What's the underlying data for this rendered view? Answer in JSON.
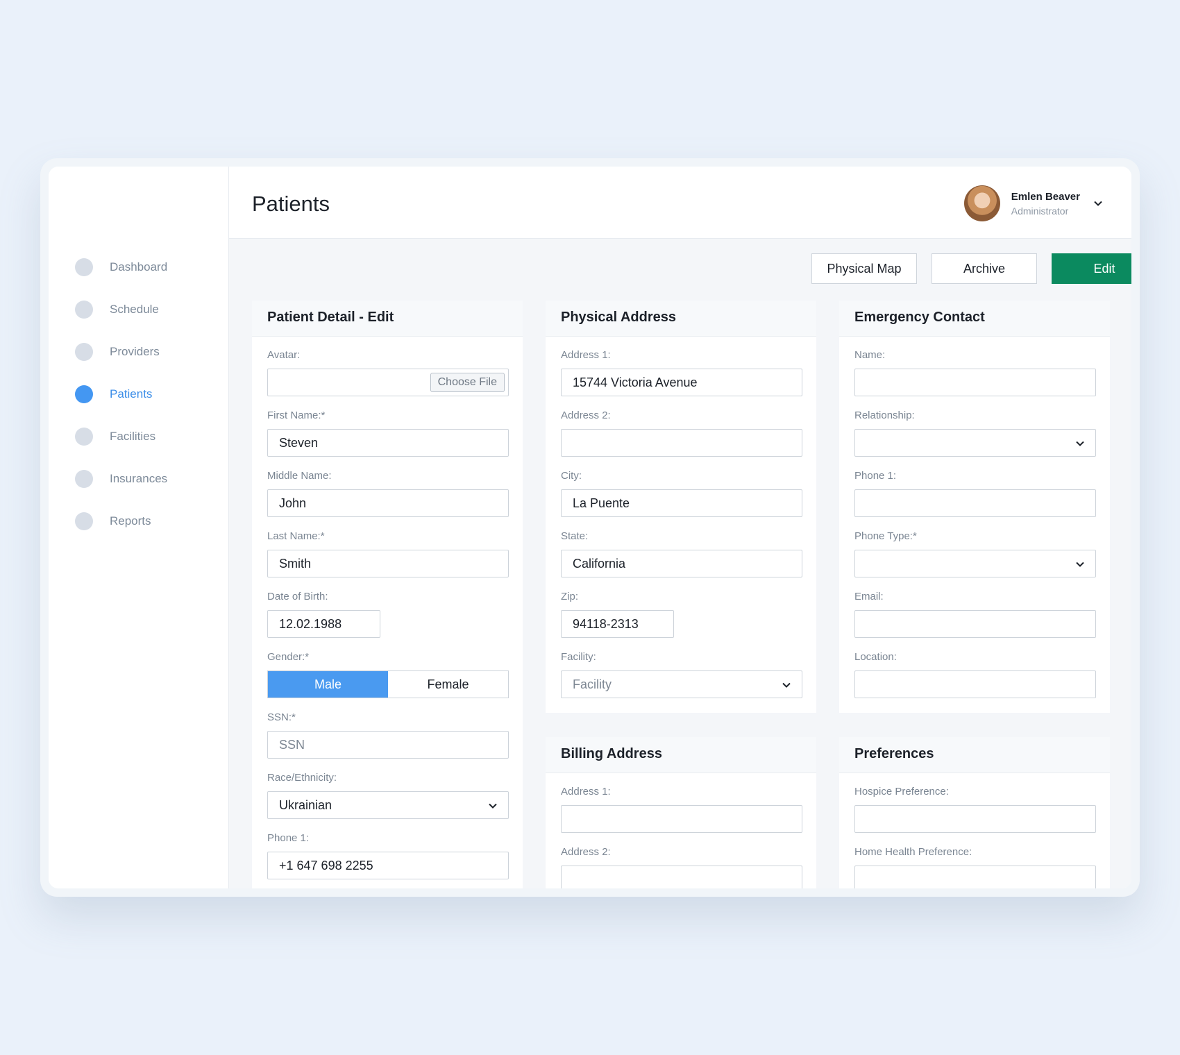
{
  "nav": {
    "items": [
      {
        "label": "Dashboard"
      },
      {
        "label": "Schedule"
      },
      {
        "label": "Providers"
      },
      {
        "label": "Patients"
      },
      {
        "label": "Facilities"
      },
      {
        "label": "Insurances"
      },
      {
        "label": "Reports"
      }
    ]
  },
  "header": {
    "title": "Patients",
    "user": {
      "name": "Emlen Beaver",
      "role": "Administrator"
    }
  },
  "toolbar": {
    "physical_map": "Physical Map",
    "archive": "Archive",
    "edit": "Edit"
  },
  "patient": {
    "title": "Patient Detail - Edit",
    "avatar_label": "Avatar:",
    "choose_file": "Choose File",
    "first_name_label": "First Name:*",
    "first_name": "Steven",
    "middle_name_label": "Middle Name:",
    "middle_name": "John",
    "last_name_label": "Last Name:*",
    "last_name": "Smith",
    "dob_label": "Date of Birth:",
    "dob": "12.02.1988",
    "gender_label": "Gender:*",
    "gender_male": "Male",
    "gender_female": "Female",
    "gender_selected": "Male",
    "ssn_label": "SSN:*",
    "ssn_placeholder": "SSN",
    "race_label": "Race/Ethnicity:",
    "race": "Ukrainian",
    "phone_label": "Phone 1:",
    "phone": "+1 647 698 2255"
  },
  "physical": {
    "title": "Physical Address",
    "address1_label": "Address 1:",
    "address1": "15744 Victoria Avenue",
    "address2_label": "Address 2:",
    "address2": "",
    "city_label": "City:",
    "city": "La Puente",
    "state_label": "State:",
    "state": "California",
    "zip_label": "Zip:",
    "zip": "94118-2313",
    "facility_label": "Facility:",
    "facility_placeholder": "Facility"
  },
  "emergency": {
    "title": "Emergency Contact",
    "name_label": "Name:",
    "relationship_label": "Relationship:",
    "phone_label": "Phone 1:",
    "phone_type_label": "Phone Type:*",
    "email_label": "Email:",
    "location_label": "Location:"
  },
  "billing": {
    "title": "Billing Address",
    "address1_label": "Address 1:",
    "address2_label": "Address 2:"
  },
  "preferences": {
    "title": "Preferences",
    "hospice_label": "Hospice Preference:",
    "home_health_label": "Home Health Preference:"
  },
  "colors": {
    "accent": "#4a9af0",
    "primary": "#0b8a5f",
    "background": "#eaf1fa"
  }
}
